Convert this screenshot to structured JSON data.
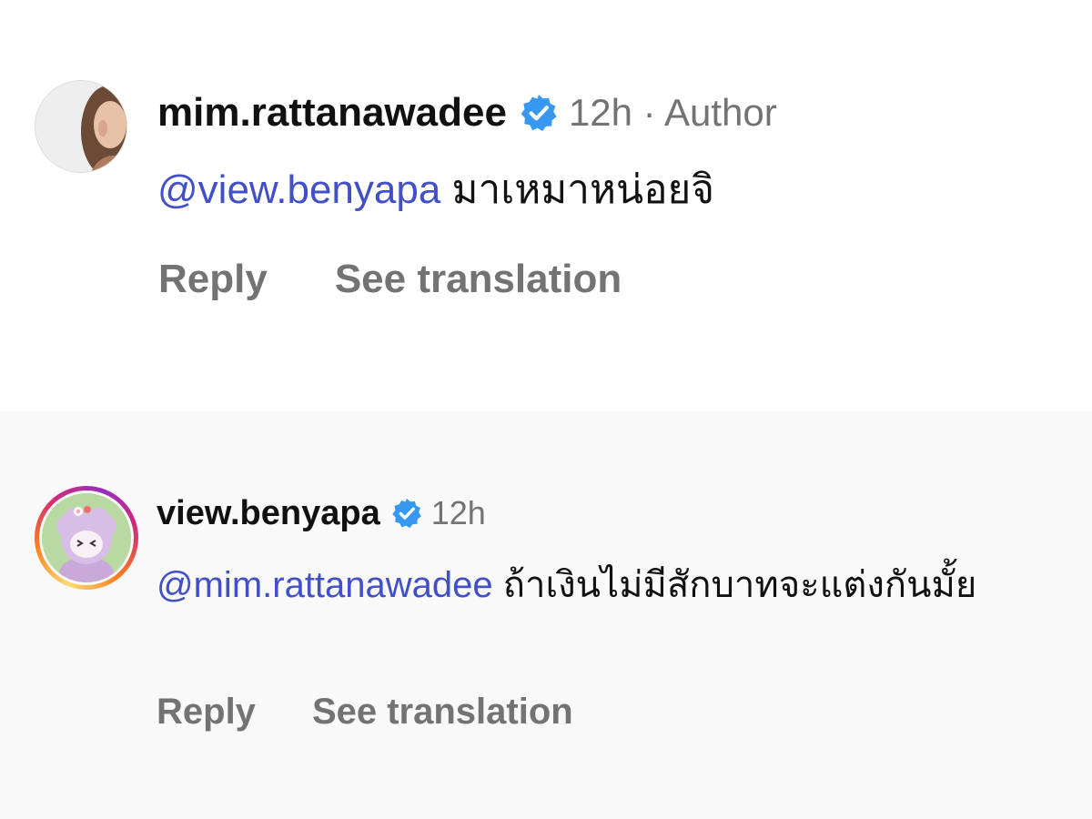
{
  "comments": [
    {
      "username": "mim.rattanawadee",
      "verified": true,
      "meta": "12h · Author",
      "mention": "@view.benyapa",
      "text": "มาเหมาหน่อยจิ",
      "reply_label": "Reply",
      "translate_label": "See translation",
      "avatar_icon": "profile-photo"
    },
    {
      "username": "view.benyapa",
      "verified": true,
      "meta": "12h",
      "mention": "@mim.rattanawadee",
      "text": "ถ้าเงินไม่มีสักบาทจะแต่งกันมั้ย",
      "reply_label": "Reply",
      "translate_label": "See translation",
      "avatar_icon": "cartoon-avatar-with-story-ring"
    }
  ],
  "colors": {
    "mention": "#4150c7",
    "verified_badge": "#3897f0",
    "meta_gray": "#737373",
    "text": "#111111"
  }
}
